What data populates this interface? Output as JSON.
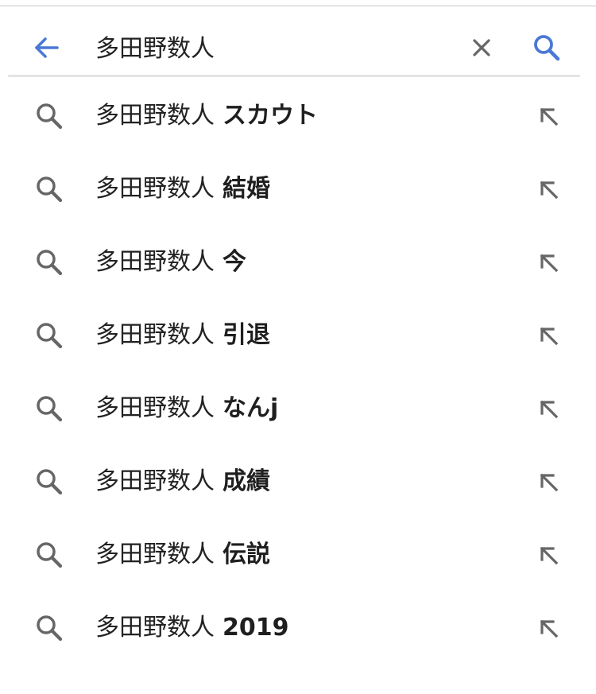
{
  "search": {
    "query": "多田野数人",
    "icons": {
      "back": "arrow-back-icon",
      "clear": "close-icon",
      "search": "search-icon"
    }
  },
  "colors": {
    "accent": "#4a78d6",
    "icon_gray": "#666666",
    "text": "#222222"
  },
  "suggestions": [
    {
      "base": "多田野数人",
      "completion": "スカウト"
    },
    {
      "base": "多田野数人",
      "completion": "結婚"
    },
    {
      "base": "多田野数人",
      "completion": "今"
    },
    {
      "base": "多田野数人",
      "completion": "引退"
    },
    {
      "base": "多田野数人",
      "completion": "なんj"
    },
    {
      "base": "多田野数人",
      "completion": "成績"
    },
    {
      "base": "多田野数人",
      "completion": "伝説"
    },
    {
      "base": "多田野数人",
      "completion": "2019"
    }
  ]
}
